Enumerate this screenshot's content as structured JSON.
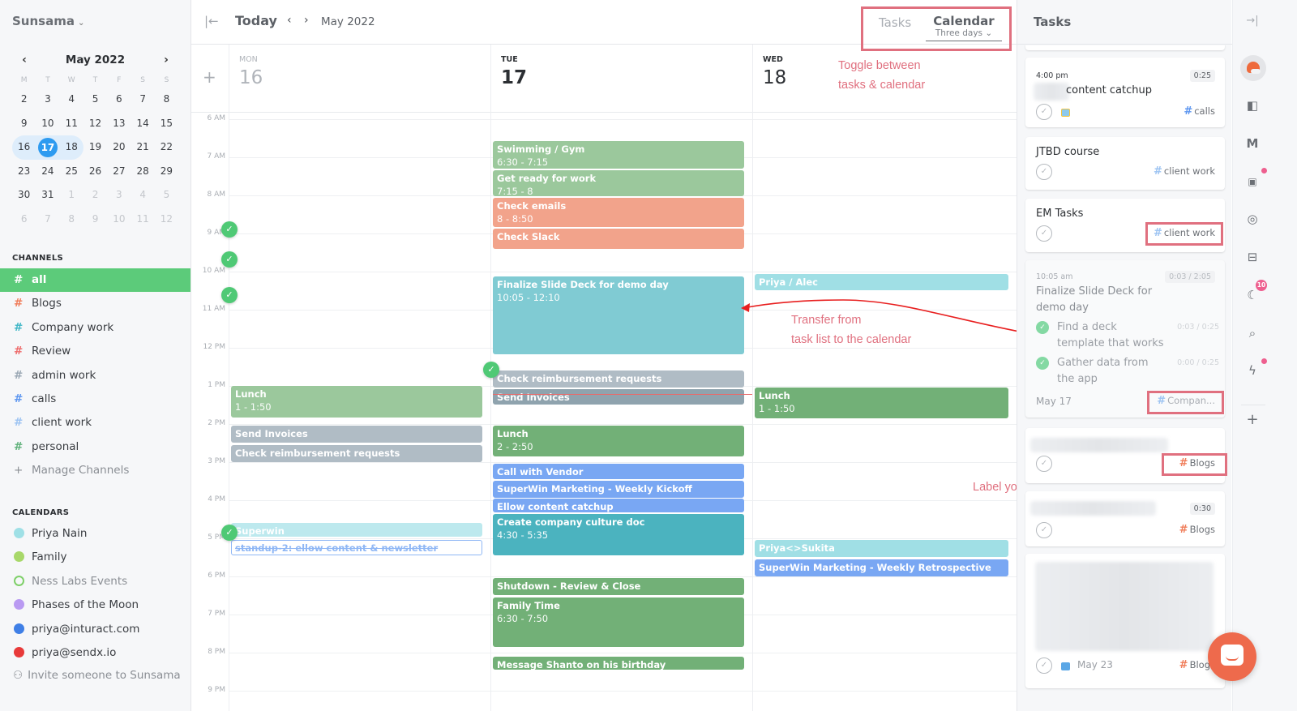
{
  "app": {
    "name": "Sunsama"
  },
  "mini_calendar": {
    "title": "May 2022",
    "weekdays": [
      "M",
      "T",
      "W",
      "T",
      "F",
      "S",
      "S"
    ],
    "weeks": [
      [
        {
          "d": "2"
        },
        {
          "d": "3"
        },
        {
          "d": "4"
        },
        {
          "d": "5"
        },
        {
          "d": "6"
        },
        {
          "d": "7"
        },
        {
          "d": "8"
        }
      ],
      [
        {
          "d": "9"
        },
        {
          "d": "10"
        },
        {
          "d": "11"
        },
        {
          "d": "12"
        },
        {
          "d": "13"
        },
        {
          "d": "14"
        },
        {
          "d": "15"
        }
      ],
      [
        {
          "d": "16",
          "state": "range-start"
        },
        {
          "d": "17",
          "state": "today"
        },
        {
          "d": "18",
          "state": "range-end"
        },
        {
          "d": "19"
        },
        {
          "d": "20"
        },
        {
          "d": "21"
        },
        {
          "d": "22"
        }
      ],
      [
        {
          "d": "23"
        },
        {
          "d": "24"
        },
        {
          "d": "25"
        },
        {
          "d": "26"
        },
        {
          "d": "27"
        },
        {
          "d": "28"
        },
        {
          "d": "29"
        }
      ],
      [
        {
          "d": "30"
        },
        {
          "d": "31"
        },
        {
          "d": "1",
          "dim": true
        },
        {
          "d": "2",
          "dim": true
        },
        {
          "d": "3",
          "dim": true
        },
        {
          "d": "4",
          "dim": true
        },
        {
          "d": "5",
          "dim": true
        }
      ],
      [
        {
          "d": "6",
          "dim": true
        },
        {
          "d": "7",
          "dim": true
        },
        {
          "d": "8",
          "dim": true
        },
        {
          "d": "9",
          "dim": true
        },
        {
          "d": "10",
          "dim": true
        },
        {
          "d": "11",
          "dim": true
        },
        {
          "d": "12",
          "dim": true
        }
      ]
    ]
  },
  "channels": {
    "label": "CHANNELS",
    "items": [
      {
        "name": "all",
        "color": "#ffffff",
        "active": true
      },
      {
        "name": "Blogs",
        "color": "#f07d5a"
      },
      {
        "name": "Company work",
        "color": "#3fb6c6"
      },
      {
        "name": "Review",
        "color": "#ee6b6b"
      },
      {
        "name": "admin work",
        "color": "#9aa7b4"
      },
      {
        "name": "calls",
        "color": "#5b95f0"
      },
      {
        "name": "client work",
        "color": "#9cc3f2"
      },
      {
        "name": "personal",
        "color": "#5fb17a"
      }
    ],
    "manage_label": "Manage Channels"
  },
  "calendars": {
    "label": "CALENDARS",
    "items": [
      {
        "name": "Priya Nain",
        "color": "#9fe0e6",
        "enabled": true
      },
      {
        "name": "Family",
        "color": "#a8d86a",
        "enabled": true
      },
      {
        "name": "Ness Labs Events",
        "color": "#7fd06a",
        "enabled": false
      },
      {
        "name": "Phases of the Moon",
        "color": "#b99af2",
        "enabled": true
      },
      {
        "name": "priya@inturact.com",
        "color": "#3f7fe6",
        "enabled": true
      },
      {
        "name": "priya@sendx.io",
        "color": "#e83a3a",
        "enabled": true
      }
    ],
    "invite_label": "Invite someone to Sunsama"
  },
  "topbar": {
    "today_label": "Today",
    "month_label": "May 2022",
    "tabs": {
      "tasks": "Tasks",
      "calendar": "Calendar",
      "calendar_sub": "Three days"
    }
  },
  "days": [
    {
      "dow": "MON",
      "num": "16",
      "state": "past"
    },
    {
      "dow": "TUE",
      "num": "17",
      "state": "current"
    },
    {
      "dow": "WED",
      "num": "18",
      "state": "future"
    }
  ],
  "hours": [
    "6 AM",
    "7 AM",
    "8 AM",
    "9 AM",
    "10 AM",
    "11 AM",
    "12 PM",
    "1 PM",
    "2 PM",
    "3 PM",
    "4 PM",
    "5 PM",
    "6 PM",
    "7 PM",
    "8 PM",
    "9 PM"
  ],
  "events": [
    {
      "day": 0,
      "title": "Lunch",
      "time": "1 - 1:50",
      "start": 13.0,
      "end": 13.83,
      "color": "#9bc89c"
    },
    {
      "day": 0,
      "title": "Send Invoices",
      "start": 14.05,
      "end": 14.5,
      "color": "#b0bcc5"
    },
    {
      "day": 0,
      "title": "Check reimbursement requests",
      "start": 14.55,
      "end": 15.0,
      "color": "#b0bcc5"
    },
    {
      "day": 0,
      "title": "Superwin",
      "start": 16.6,
      "end": 16.95,
      "color": "#bde9ee"
    },
    {
      "day": 0,
      "title": "standup-2: ellow content & newsletter",
      "start": 17.05,
      "end": 17.45,
      "color": "#ffffff",
      "outline": true
    },
    {
      "day": 1,
      "title": "Swimming / Gym",
      "time": "6:30 - 7:15",
      "start": 6.58,
      "end": 7.3,
      "color": "#9bc89c"
    },
    {
      "day": 1,
      "title": "Get ready for work",
      "time": "7:15 - 8",
      "start": 7.33,
      "end": 8.03,
      "color": "#9bc89c"
    },
    {
      "day": 1,
      "title": "Check emails",
      "time": "8 - 8:50",
      "start": 8.07,
      "end": 8.83,
      "color": "#f2a38b"
    },
    {
      "day": 1,
      "title": "Check Slack",
      "start": 8.87,
      "end": 9.4,
      "color": "#f2a38b"
    },
    {
      "day": 1,
      "title": "Finalize Slide Deck for demo day",
      "time": "10:05 - 12:10",
      "start": 10.12,
      "end": 12.18,
      "color": "#80cbd3"
    },
    {
      "day": 1,
      "title": "Check reimbursement requests",
      "start": 12.6,
      "end": 13.05,
      "color": "#b0bcc5"
    },
    {
      "day": 1,
      "title": "Send Invoices",
      "start": 13.08,
      "end": 13.5,
      "color": "#8fa3ae"
    },
    {
      "day": 1,
      "title": "Lunch",
      "time": "2 - 2:50",
      "start": 14.05,
      "end": 14.85,
      "color": "#72b077"
    },
    {
      "day": 1,
      "title": "Call with Vendor",
      "start": 15.05,
      "end": 15.45,
      "color": "#79a7f3"
    },
    {
      "day": 1,
      "title": "SuperWin Marketing - Weekly Kickoff",
      "start": 15.48,
      "end": 15.93,
      "color": "#79a7f3"
    },
    {
      "day": 1,
      "title": "Ellow content catchup",
      "start": 15.96,
      "end": 16.33,
      "color": "#79a7f3"
    },
    {
      "day": 1,
      "title": "Create company culture doc",
      "time": "4:30 - 5:35",
      "start": 16.37,
      "end": 17.45,
      "color": "#4bb3bf"
    },
    {
      "day": 1,
      "title": "Shutdown - Review & Close",
      "start": 18.05,
      "end": 18.5,
      "color": "#72b077"
    },
    {
      "day": 1,
      "title": "Family Time",
      "time": "6:30 - 7:50",
      "start": 18.55,
      "end": 19.85,
      "color": "#72b077"
    },
    {
      "day": 1,
      "title": "Message Shanto on his birthday",
      "start": 20.1,
      "end": 20.45,
      "color": "#72b077"
    },
    {
      "day": 2,
      "title": "Priya / Alec",
      "start": 10.07,
      "end": 10.5,
      "color": "#a0dfe5"
    },
    {
      "day": 2,
      "title": "Lunch",
      "time": "1 - 1:50",
      "start": 13.05,
      "end": 13.85,
      "color": "#72b077"
    },
    {
      "day": 2,
      "title": "Priya<>Sukita",
      "start": 17.05,
      "end": 17.5,
      "color": "#a0dfe5"
    },
    {
      "day": 2,
      "title": "SuperWin Marketing - Weekly Retrospective",
      "start": 17.55,
      "end": 18.0,
      "color": "#79a7f3"
    }
  ],
  "done_checks": [
    {
      "col": "gutter",
      "at": 8.9
    },
    {
      "col": "gutter",
      "at": 9.68
    },
    {
      "col": "gutter",
      "at": 10.62
    },
    {
      "col": "tue-edge",
      "at": 12.58
    },
    {
      "col": "gutter",
      "at": 16.85
    }
  ],
  "annotations": {
    "toggle": [
      "Toggle between",
      "tasks & calendar"
    ],
    "transfer": [
      "Transfer from",
      "task list to the calendar"
    ],
    "label": "Label your task / Assign it to a channel"
  },
  "task_panel": {
    "title": "Tasks",
    "cards": [
      {
        "time": "4:00 pm",
        "title": "content catchup",
        "duration": "0:25",
        "channel": "calls",
        "channel_color": "#5b95f0"
      },
      {
        "title": "JTBD course",
        "channel": "client work",
        "channel_color": "#9cc3f2"
      },
      {
        "title": "EM Tasks",
        "channel": "client work",
        "channel_color": "#9cc3f2"
      },
      {
        "time": "10:05 am",
        "title": "Finalize Slide Deck for demo day",
        "duration": "0:03 / 2:05",
        "subtasks": [
          {
            "title": "Find a deck template that works",
            "duration": "0:03 / 0:25"
          },
          {
            "title": "Gather data from the app",
            "duration": "0:00 / 0:25"
          }
        ],
        "date": "May 17",
        "channel": "Compan...",
        "channel_color": "#3fb6c6"
      },
      {
        "channel": "Blogs",
        "channel_color": "#f07d5a"
      },
      {
        "duration": "0:30",
        "channel": "Blogs",
        "channel_color": "#f07d5a"
      },
      {
        "date": "May 23",
        "channel": "Blogs",
        "channel_color": "#f07d5a"
      }
    ]
  },
  "rail": {
    "badges": {
      "sleep": "10"
    }
  },
  "colors": {
    "accent": "#5ccb7a",
    "today": "#2e9bf0",
    "annotation": "#e0707f"
  }
}
